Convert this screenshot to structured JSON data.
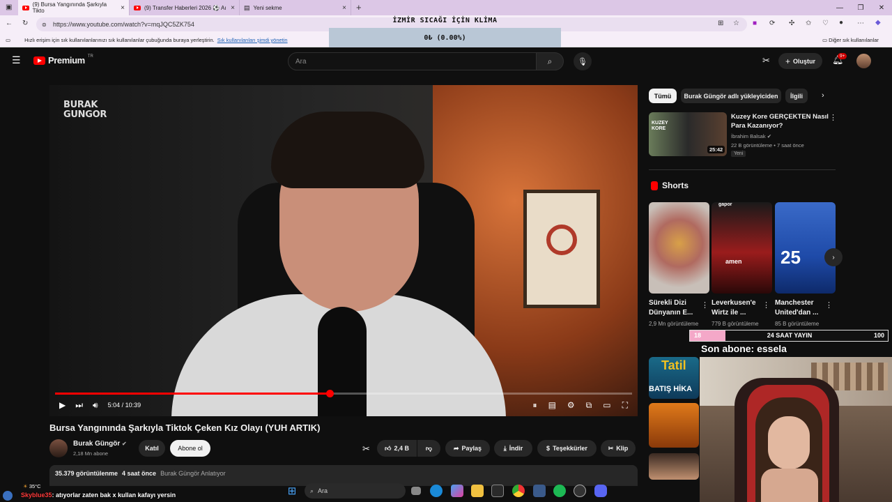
{
  "browser": {
    "tabs": [
      {
        "label": "(9) Bursa Yangınında Şarkıyla Tikto",
        "close": "×"
      },
      {
        "label": "(9) Transfer Haberleri 2026 ⚽ Aı",
        "close": "×"
      },
      {
        "label": "Yeni sekme",
        "close": "×"
      }
    ],
    "new_tab": "+",
    "url": "https://www.youtube.com/watch?v=mqJQC5ZK754",
    "bookmarks_hint": "Hızlı erişim için sık kullanılanlarınızı sık kullanılanlar çubuğunda buraya yerleştirin.",
    "bookmarks_link": "Sık kullanılanları şimdi yönetin",
    "other_favorites": "Diğer sık kullanılanlar"
  },
  "overlay": {
    "goal_title": "İZMİR SICAĞI İÇİN KLİMA",
    "goal_amount": "0₺ (0.00%)",
    "sub_goal_current": "18",
    "sub_goal_label": "24 SAAT YAYIN",
    "sub_goal_target": "100",
    "sub_goal_progress": 0.18,
    "last_sub": "Son abone: essela",
    "chat_user": "Skyblue35",
    "chat_message": ": atıyorlar zaten bak x kullan kafayı yersin"
  },
  "youtube": {
    "logo": "Premium",
    "logo_region": "TR",
    "search_placeholder": "Ara",
    "create_label": "Oluştur",
    "notif_badge": "9+",
    "video": {
      "channel_watermark_1": "BURAK",
      "channel_watermark_2": "GUNGOR",
      "time": "5:04 / 10:39",
      "progress": 0.476,
      "title": "Bursa Yangınında Şarkıyla Tiktok Çeken Kız Olayı (YUH ARTIK)"
    },
    "channel": {
      "name": "Burak Güngör",
      "subs": "2,18 Mn abone",
      "join": "Katıl",
      "subscribe": "Abone ol"
    },
    "actions": {
      "likes": "2,4 B",
      "share": "Paylaş",
      "download": "İndir",
      "thanks": "Teşekkürler",
      "clip": "Klip"
    },
    "description": {
      "views": "35.379 görüntülenme",
      "ago": "4 saat önce",
      "tags": "Burak Güngör Anlatıyor"
    },
    "chips": [
      "Tümü",
      "Burak Güngör adlı yükleyiciden",
      "İlgili"
    ],
    "recommended": {
      "title": "Kuzey Kore GERÇEKTEN Nasıl Para Kazanıyor?",
      "channel": "İbrahim Balsak",
      "meta": "22 B görüntüleme • 7 saat önce",
      "badge": "Yeni",
      "duration": "25:42",
      "thumb_text": "KUZEY KORE"
    },
    "shorts_heading": "Shorts",
    "shorts": [
      {
        "title": "Sürekli Dizi Dünyanın E...",
        "views": "2,9 Mn görüntüleme"
      },
      {
        "title": "Leverkusen'e Wirtz ile ...",
        "views": "779 B görüntüleme"
      },
      {
        "title": "Manchester United'dan ...",
        "views": "85 B görüntüleme"
      }
    ],
    "short_thumb_text": [
      "",
      "amen",
      "25"
    ],
    "short_thumb_badge": "gapor",
    "second_thumb_text": "Tatil",
    "second_thumb_sub": "BATIŞ HİKA"
  },
  "taskbar": {
    "temp": "35°C",
    "search": "Ara"
  },
  "colors": {
    "yt_red": "#ff0000",
    "bg": "#0f0f0f",
    "pink": "#f4a8c8"
  }
}
